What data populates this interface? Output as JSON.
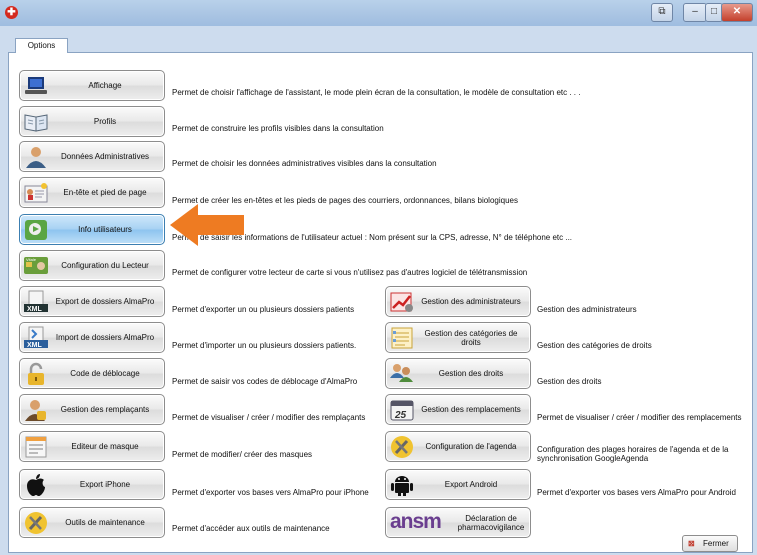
{
  "tab": {
    "label": "Options"
  },
  "close_button": {
    "label": "Fermer"
  },
  "left": [
    {
      "label": "Affichage",
      "desc": "Permet de choisir l'affichage de l'assistant, le mode plein écran de la consultation, le modèle de consultation etc . . ."
    },
    {
      "label": "Profils",
      "desc": "Permet de construire les profils visibles dans la consultation"
    },
    {
      "label": "Données Administratives",
      "desc": "Permet de choisir les données administratives visibles dans la consultation"
    },
    {
      "label": "En-tête et pied de page",
      "desc": "Permet de créer les en-têtes et les pieds de pages des courriers, ordonnances, bilans biologiques"
    },
    {
      "label": "Info utilisateurs",
      "desc": "Permet de saisir les informations de l'utilisateur actuel : Nom présent sur la CPS, adresse, N° de téléphone etc ..."
    },
    {
      "label": "Configuration du Lecteur",
      "desc": "Permet de configurer votre lecteur de carte si vous n'utilisez pas d'autres logiciel de télétransmission"
    },
    {
      "label": "Export de dossiers AlmaPro",
      "desc": "Permet d'exporter un ou plusieurs dossiers patients"
    },
    {
      "label": "Import de dossiers AlmaPro",
      "desc": "Permet d'importer un ou plusieurs dossiers patients."
    },
    {
      "label": "Code de déblocage",
      "desc": "Permet de saisir vos codes de déblocage d'AlmaPro"
    },
    {
      "label": "Gestion des remplaçants",
      "desc": "Permet de visualiser / créer / modifier des remplaçants"
    },
    {
      "label": "Editeur de masque",
      "desc": "Permet de modifier/ créer des masques"
    },
    {
      "label": "Export iPhone",
      "desc": "Permet d'exporter vos bases vers AlmaPro pour iPhone"
    },
    {
      "label": "Outils de maintenance",
      "desc": "Permet d'accéder aux outils de maintenance"
    }
  ],
  "right": [
    {
      "label": "Gestion des administrateurs",
      "desc": "Gestion des administrateurs"
    },
    {
      "label": "Gestion des catégories de droits",
      "desc": "Gestion des catégories de droits"
    },
    {
      "label": "Gestion des droits",
      "desc": "Gestion des droits"
    },
    {
      "label": "Gestion des remplacements",
      "desc": "Permet de visualiser / créer / modifier des remplacements"
    },
    {
      "label": "Configuration de l'agenda",
      "desc": "Configuration des plages horaires de l'agenda et de la synchronisation GoogleAgenda"
    },
    {
      "label": "Export Android",
      "desc": "Permet d'exporter vos bases vers AlmaPro pour Android"
    },
    {
      "label": "Déclaration de pharmacovigilance",
      "desc": ""
    }
  ],
  "icons": {
    "xml": "XML",
    "calendar_day": "25",
    "ansm": "ansm",
    "vitale": "Vitale"
  },
  "colors": {
    "highlight": "#9fcdf1",
    "arrow": "#ee7b22"
  }
}
